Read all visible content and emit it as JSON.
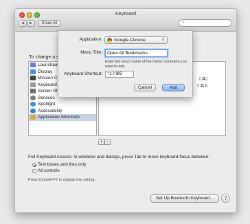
{
  "window": {
    "title": "Keyboard"
  },
  "toolbar": {
    "back": "◀",
    "forward": "▶",
    "show_all": "Show All",
    "search_placeholder": ""
  },
  "main": {
    "label": "To change a s"
  },
  "left_list": [
    {
      "label": "Launchpad",
      "icon": "launchpad-icon",
      "color": "#6b7fc9"
    },
    {
      "label": "Display",
      "icon": "display-icon",
      "color": "#4f8fd6"
    },
    {
      "label": "Mission Co",
      "icon": "mission-control-icon",
      "color": "#444444"
    },
    {
      "label": "Keyboard",
      "icon": "keyboard-icon",
      "color": "#9a9a9a"
    },
    {
      "label": "Screen Sho",
      "icon": "screenshot-icon",
      "color": "#6f6f6f"
    },
    {
      "label": "Services",
      "icon": "gear-icon",
      "color": "#7a7a7a"
    },
    {
      "label": "Spotlight",
      "icon": "spotlight-icon",
      "color": "#4a8bd6"
    },
    {
      "label": "Accessibility",
      "icon": "accessibility-icon",
      "color": "#3a7bd5"
    },
    {
      "label": "Application Shortcuts",
      "icon": "app-shortcuts-icon",
      "color": "#d6a84a",
      "selected": true
    }
  ],
  "right_list": {
    "shortcut_1": "⇧⌘/",
    "shortcut_2": "⇧⌘S"
  },
  "plus_label": "+",
  "minus_label": "−",
  "full_keyboard_access": "Full Keyboard Access: In windows and dialogs, press Tab to move keyboard focus between:",
  "radio_options": [
    {
      "label": "Text boxes and lists only",
      "checked": true
    },
    {
      "label": "All controls",
      "checked": false
    }
  ],
  "hint": "Press Control+F7 to change this setting.",
  "bluetooth_button": "Set Up Bluetooth Keyboard...",
  "help_label": "?",
  "sheet": {
    "application_label": "Application:",
    "application_value": "Google Chrome",
    "menu_title_label": "Menu Title:",
    "menu_title_value": "Open All Bookmarks",
    "help_text": "Enter the exact name of the menu command you want to add.",
    "shortcut_label": "Keyboard Shortcut:",
    "shortcut_value": "⌥⇧⌘B",
    "cancel_label": "Cancel",
    "add_label": "Add"
  }
}
